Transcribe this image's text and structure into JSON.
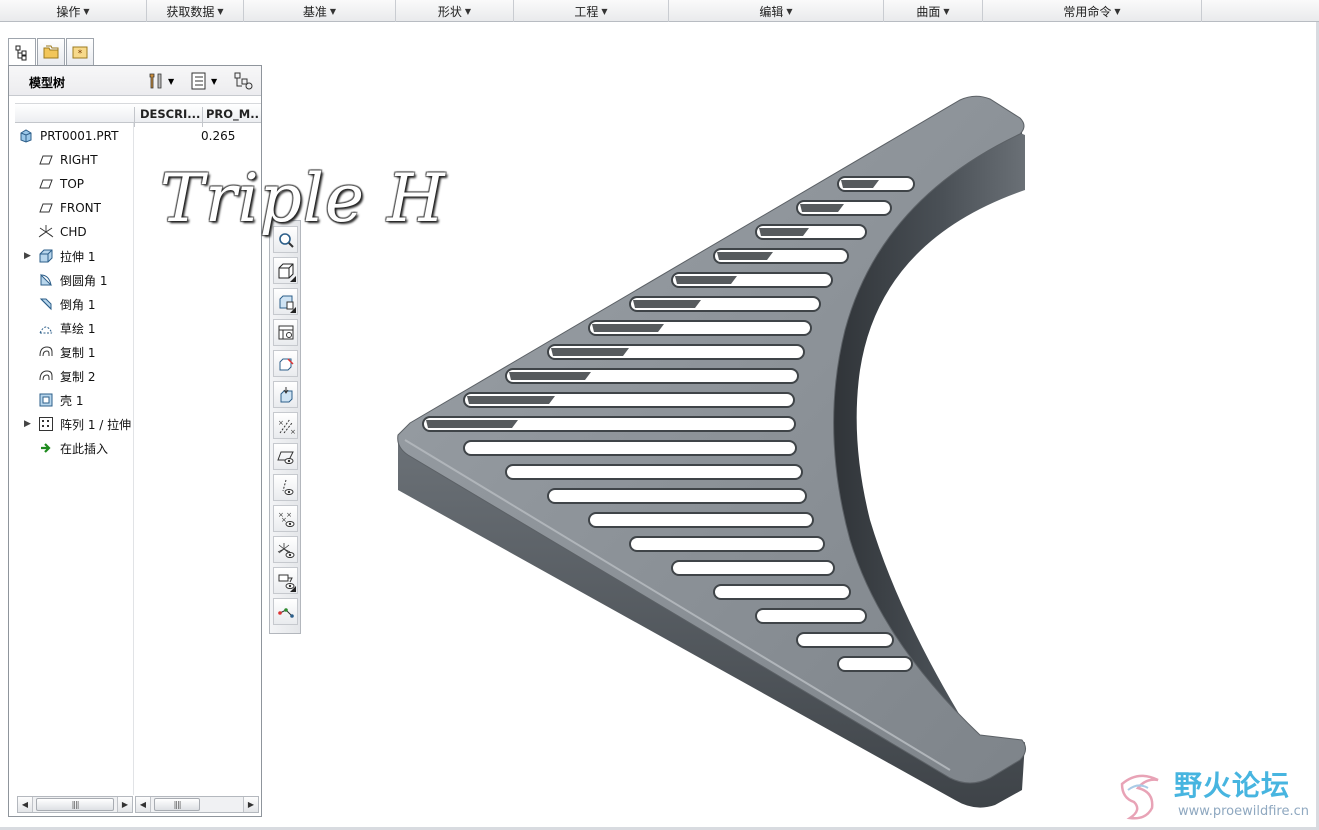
{
  "ribbon": {
    "groups": [
      {
        "label": "操作"
      },
      {
        "label": "获取数据"
      },
      {
        "label": "基准"
      },
      {
        "label": "形状"
      },
      {
        "label": "工程"
      },
      {
        "label": "编辑"
      },
      {
        "label": "曲面"
      },
      {
        "label": "常用命令"
      }
    ]
  },
  "navigator": {
    "tabs": [
      {
        "icon": "model-tree-icon",
        "active": true
      },
      {
        "icon": "folder-browser-icon",
        "active": false
      },
      {
        "icon": "favorites-icon",
        "active": false
      }
    ]
  },
  "model_tree": {
    "title": "模型树",
    "columns": [
      "DESCRI...",
      "PRO_M..."
    ],
    "root": {
      "label": "PRT0001.PRT",
      "value": "0.265",
      "icon": "part-icon"
    },
    "items": [
      {
        "label": "RIGHT",
        "icon": "datum-plane-icon",
        "expandable": false
      },
      {
        "label": "TOP",
        "icon": "datum-plane-icon",
        "expandable": false
      },
      {
        "label": "FRONT",
        "icon": "datum-plane-icon",
        "expandable": false
      },
      {
        "label": "CHD",
        "icon": "coordinate-system-icon",
        "expandable": false
      },
      {
        "label": "拉伸 1",
        "icon": "extrude-icon",
        "expandable": true
      },
      {
        "label": "倒圆角 1",
        "icon": "round-icon",
        "expandable": false
      },
      {
        "label": "倒角 1",
        "icon": "chamfer-icon",
        "expandable": false
      },
      {
        "label": "草绘 1",
        "icon": "sketch-icon",
        "expandable": false
      },
      {
        "label": "复制 1",
        "icon": "copy-surface-icon",
        "expandable": false
      },
      {
        "label": "复制 2",
        "icon": "copy-surface-icon",
        "expandable": false
      },
      {
        "label": "壳 1",
        "icon": "shell-icon",
        "expandable": false
      },
      {
        "label": "阵列 1 / 拉伸",
        "icon": "pattern-icon",
        "expandable": true
      },
      {
        "label": "在此插入",
        "icon": "insert-here-arrow-icon",
        "expandable": false
      }
    ]
  },
  "overlay": {
    "watermark": "Triple H",
    "forum_name": "野火论坛",
    "forum_url": "www.proewildfire.cn"
  },
  "colors": {
    "part_top": "#8a9096",
    "part_side": "#4d5358",
    "part_dark": "#2f3438",
    "forum_blue": "#47b5e0"
  }
}
